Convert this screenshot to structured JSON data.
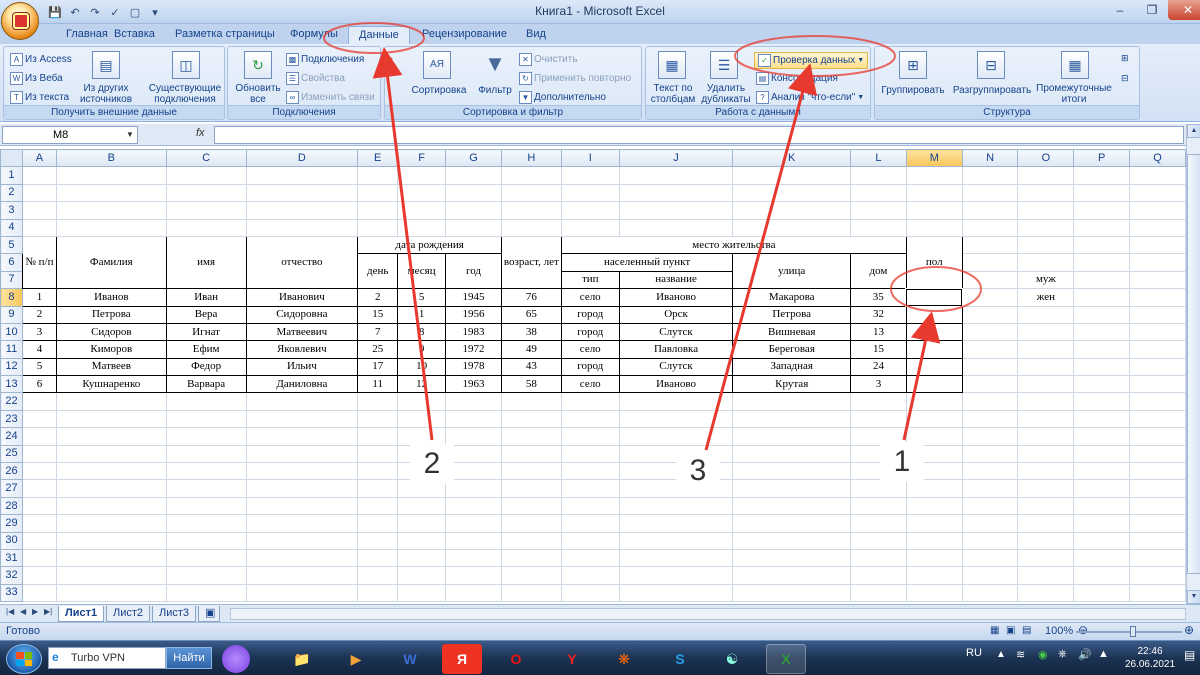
{
  "window": {
    "title": "Книга1 - Microsoft Excel"
  },
  "tabs": [
    "Главная",
    "Вставка",
    "Разметка страницы",
    "Формулы",
    "Данные",
    "Рецензирование",
    "Вид"
  ],
  "ribbon": {
    "get_external": {
      "label": "Получить внешние данные",
      "access": "Из Access",
      "web": "Из Веба",
      "text": "Из текста",
      "other1": "Из других",
      "other2": "источников",
      "existing1": "Существующие",
      "existing2": "подключения"
    },
    "connections": {
      "label": "Подключения",
      "refresh1": "Обновить",
      "refresh2": "все",
      "conns": "Подключения",
      "props": "Свойства",
      "edit_links": "Изменить связи"
    },
    "sort_filter": {
      "label": "Сортировка и фильтр",
      "sort": "Сортировка",
      "filter": "Фильтр",
      "clear": "Очистить",
      "reapply": "Применить повторно",
      "advanced": "Дополнительно"
    },
    "data_tools": {
      "label": "Работа с данными",
      "text_cols1": "Текст по",
      "text_cols2": "столбцам",
      "remove_dup1": "Удалить",
      "remove_dup2": "дубликаты",
      "validation": "Проверка данных",
      "consolidate": "Консолидация",
      "whatif": "Анализ \"что-если\""
    },
    "outline": {
      "label": "Структура",
      "group": "Группировать",
      "ungroup": "Разгруппировать",
      "subtotal1": "Промежуточные",
      "subtotal2": "итоги"
    }
  },
  "formula_bar": {
    "name_box": "M8",
    "fx": "fx",
    "value": ""
  },
  "columns": [
    "A",
    "B",
    "C",
    "D",
    "E",
    "F",
    "G",
    "H",
    "I",
    "J",
    "K",
    "L",
    "M",
    "N",
    "O",
    "P",
    "Q"
  ],
  "rows": [
    "1",
    "2",
    "3",
    "4",
    "5",
    "6",
    "7",
    "8",
    "9",
    "10",
    "11",
    "12",
    "13",
    "22",
    "23",
    "24",
    "25",
    "26",
    "27",
    "28",
    "29",
    "30",
    "31",
    "32",
    "33"
  ],
  "table": {
    "hdr_no": "№ п/п",
    "hdr_surname": "Фамилия",
    "hdr_name": "имя",
    "hdr_patronymic": "отчество",
    "hdr_birth": "дата рождения",
    "hdr_day": "день",
    "hdr_month": "месяц",
    "hdr_year": "год",
    "hdr_age": "возраст, лет",
    "hdr_residence": "место жительства",
    "hdr_settlement": "населенный пункт",
    "hdr_type": "тип",
    "hdr_sname": "название",
    "hdr_street": "улица",
    "hdr_house": "дом",
    "hdr_sex": "пол",
    "rows": [
      [
        "1",
        "Иванов",
        "Иван",
        "Иванович",
        "2",
        "5",
        "1945",
        "76",
        "село",
        "Иваново",
        "Макарова",
        "35",
        ""
      ],
      [
        "2",
        "Петрова",
        "Вера",
        "Сидоровна",
        "15",
        "1",
        "1956",
        "65",
        "город",
        "Орск",
        "Петрова",
        "32",
        ""
      ],
      [
        "3",
        "Сидоров",
        "Игнат",
        "Матвеевич",
        "7",
        "8",
        "1983",
        "38",
        "город",
        "Слутск",
        "Вишневая",
        "13",
        ""
      ],
      [
        "4",
        "Киморов",
        "Ефим",
        "Яковлевич",
        "25",
        "9",
        "1972",
        "49",
        "село",
        "Павловка",
        "Береговая",
        "15",
        ""
      ],
      [
        "5",
        "Матвеев",
        "Федор",
        "Ильич",
        "17",
        "10",
        "1978",
        "43",
        "город",
        "Слутск",
        "Западная",
        "24",
        ""
      ],
      [
        "6",
        "Кушнаренко",
        "Варвара",
        "Даниловна",
        "11",
        "12",
        "1963",
        "58",
        "село",
        "Иваново",
        "Крутая",
        "3",
        ""
      ]
    ],
    "o7": "муж",
    "o8": "жен"
  },
  "sheets": [
    "Лист1",
    "Лист2",
    "Лист3"
  ],
  "status": {
    "ready": "Готово",
    "zoom": "100%"
  },
  "taskbar": {
    "search_text": "Turbo VPN",
    "go": "Найти",
    "lang": "RU",
    "time": "22:46",
    "date": "26.06.2021"
  },
  "annotations": [
    "1",
    "2",
    "3"
  ],
  "colors": {
    "annotation": "#e8392f",
    "selection": "#000000"
  }
}
